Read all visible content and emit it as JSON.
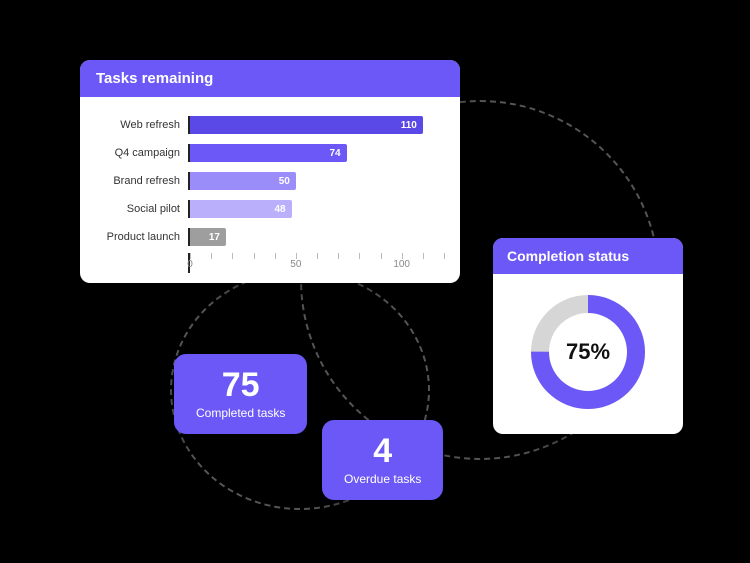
{
  "tasks_card": {
    "title": "Tasks remaining"
  },
  "status_card": {
    "title": "Completion status",
    "percent_label": "75%"
  },
  "tiles": {
    "completed": {
      "value": "75",
      "label": "Completed tasks"
    },
    "overdue": {
      "value": "4",
      "label": "Overdue tasks"
    }
  },
  "colors": {
    "accent": "#6b58f6",
    "bar_scale": [
      "#5a49e6",
      "#6b58f6",
      "#9a8df9",
      "#b9affb",
      "#9e9e9e"
    ],
    "donut_track": "#d6d6d6"
  },
  "chart_data": {
    "type": "bar",
    "title": "Tasks remaining",
    "orientation": "horizontal",
    "categories": [
      "Web refresh",
      "Q4 campaign",
      "Brand refresh",
      "Social pilot",
      "Product launch"
    ],
    "values": [
      110,
      74,
      50,
      48,
      17
    ],
    "xlabel": "",
    "ylabel": "",
    "xlim": [
      0,
      120
    ],
    "x_ticks": [
      0,
      50,
      100
    ],
    "grid": true,
    "completion_percent": 75
  }
}
